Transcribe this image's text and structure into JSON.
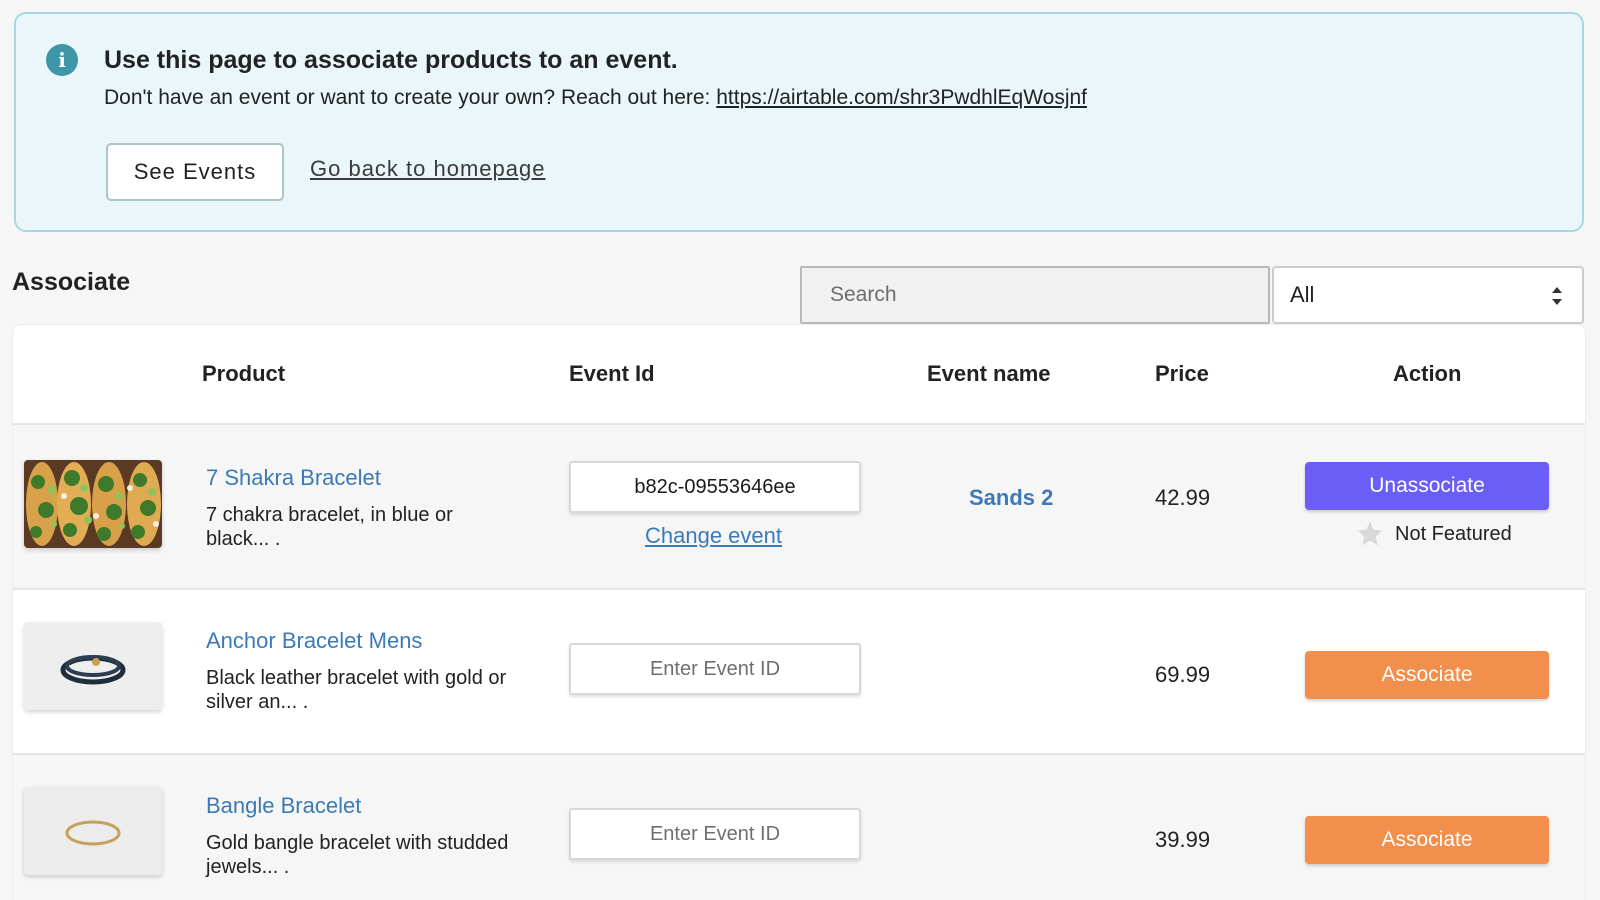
{
  "banner": {
    "title": "Use this page to associate products to an event.",
    "text": "Don't have an event or want to create your own? Reach out here: ",
    "link": "https://airtable.com/shr3PwdhlEqWosjnf",
    "see_events_label": "See Events",
    "homepage_label": "Go back to homepage"
  },
  "toolbar": {
    "section_title": "Associate",
    "search_placeholder": "Search",
    "filter_value": "All"
  },
  "table": {
    "columns": [
      "",
      "Product",
      "Event Id",
      "Event name",
      "Price",
      "Action"
    ],
    "rows": [
      {
        "image": "tacos-photo",
        "name": "7 Shakra Bracelet",
        "description": "7 chakra bracelet, in blue or black... .",
        "event_id": "b82c-09553646ee",
        "event_id_placeholder": "Enter Event ID",
        "change_label": "Change event",
        "event_name": "Sands 2",
        "price": "42.99",
        "action": "Unassociate",
        "featured_label": "Not Featured"
      },
      {
        "image": "leather-bracelet-photo",
        "name": "Anchor Bracelet Mens",
        "description": "Black leather bracelet with gold or silver an... .",
        "event_id": "",
        "event_id_placeholder": "Enter Event ID",
        "event_name": "",
        "price": "69.99",
        "action": "Associate"
      },
      {
        "image": "bangle-photo",
        "name": "Bangle Bracelet",
        "description": "Gold bangle bracelet with studded jewels... .",
        "event_id": "",
        "event_id_placeholder": "Enter Event ID",
        "event_name": "",
        "price": "39.99",
        "action": "Associate"
      }
    ]
  },
  "icons": {
    "banner": "info-icon",
    "select": "sort-arrows-icon",
    "featured": "star-icon"
  },
  "colors": {
    "banner_bg": "#eaf6fa",
    "link": "#3b7ab8",
    "unassociate": "#6a5ef6",
    "associate": "#f28f4c"
  }
}
